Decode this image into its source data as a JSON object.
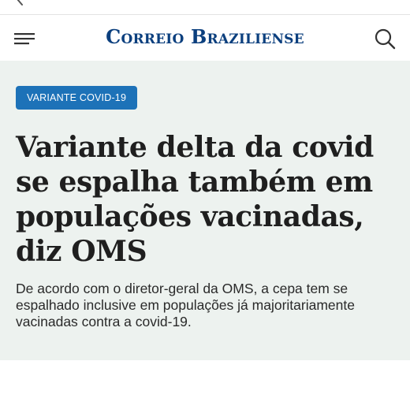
{
  "header": {
    "logo": "Correio Braziliense",
    "menu_icon": "hamburger-menu-icon",
    "search_icon": "search-icon",
    "back_icon": "chevron-left-icon"
  },
  "article": {
    "category_badge": "VARIANTE COVID-19",
    "headline": "Variante delta da covid se espalha também em populações vacinadas, diz OMS",
    "subtitle": "De acordo com o diretor-geral da OMS, a cepa tem se espalhado inclusive em populações já majoritariamente vacinadas contra a covid-19."
  },
  "colors": {
    "logo": "#0b3f7e",
    "badge_bg": "#1d72b8",
    "article_bg": "#edf2ef",
    "headline": "#1f1f1f"
  }
}
